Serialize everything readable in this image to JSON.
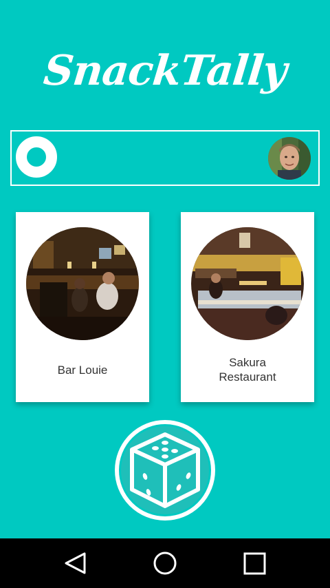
{
  "app": {
    "title": "SnackTally"
  },
  "header": {
    "ring_icon": "ring-icon",
    "avatar_icon": "user-avatar"
  },
  "restaurants": [
    {
      "name": "Bar Louie",
      "photo": "bar-interior-photo"
    },
    {
      "name": "Sakura\nRestaurant",
      "photo": "sushi-bar-photo"
    }
  ],
  "dice_button": {
    "icon": "dice-icon"
  },
  "navbar": {
    "back_icon": "back-triangle-icon",
    "home_icon": "home-circle-icon",
    "recents_icon": "recents-square-icon"
  },
  "colors": {
    "background": "#00c9c1",
    "card": "#ffffff",
    "text": "#333333",
    "navbar": "#000000"
  }
}
